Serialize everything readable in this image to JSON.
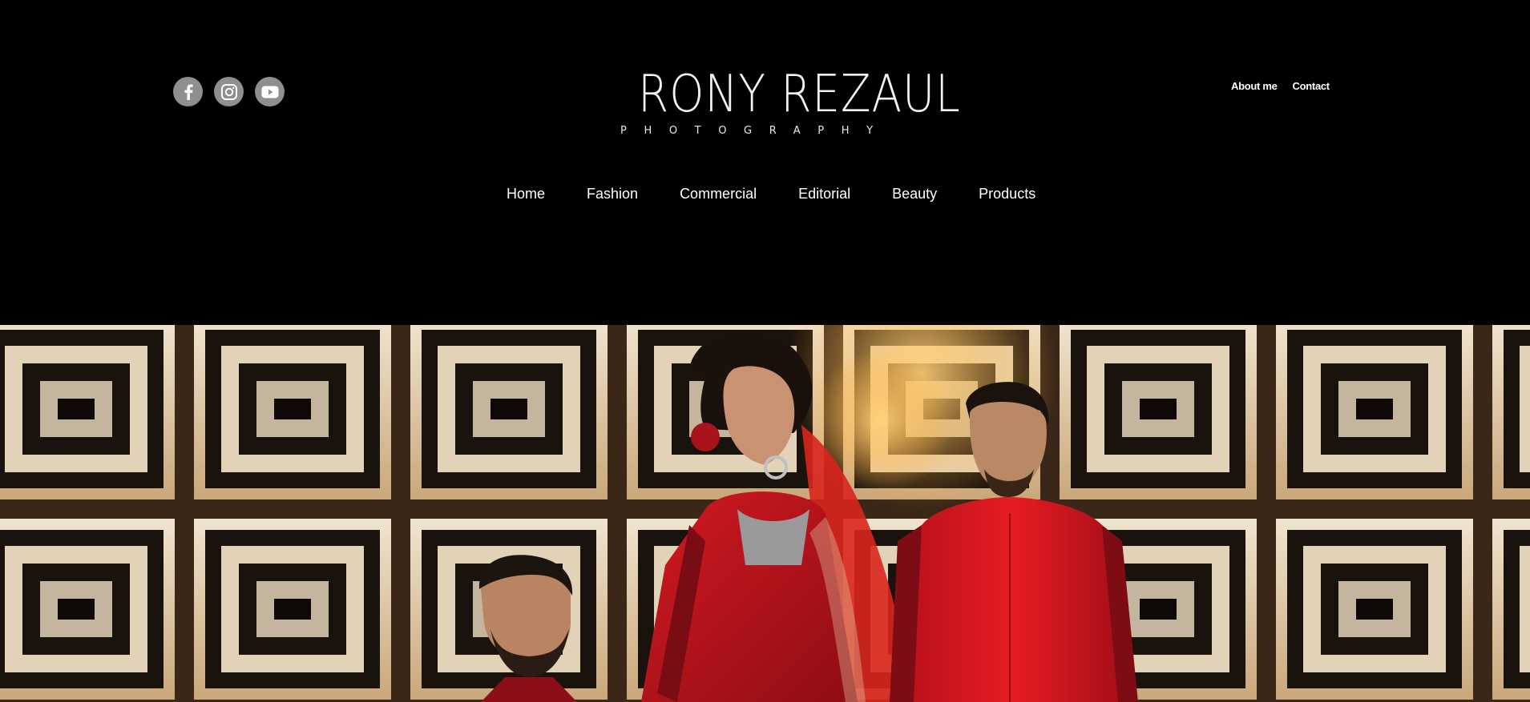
{
  "social": {
    "icons": [
      "facebook-icon",
      "instagram-icon",
      "youtube-icon"
    ]
  },
  "logo": {
    "main": "RONY REZAUL",
    "sub": "PHOTOGRAPHY"
  },
  "top_links": {
    "about": "About me",
    "contact": "Contact"
  },
  "nav": {
    "items": [
      "Home",
      "Fashion",
      "Commercial",
      "Editorial",
      "Beauty",
      "Products"
    ]
  },
  "hero": {
    "image": "three models in traditional red attire in front of an ornate gold panel wall",
    "colors": {
      "saree": "#c0141c",
      "kurta": "#d4161d",
      "panel": "#e8dcc8",
      "frame": "#1a120c"
    }
  }
}
